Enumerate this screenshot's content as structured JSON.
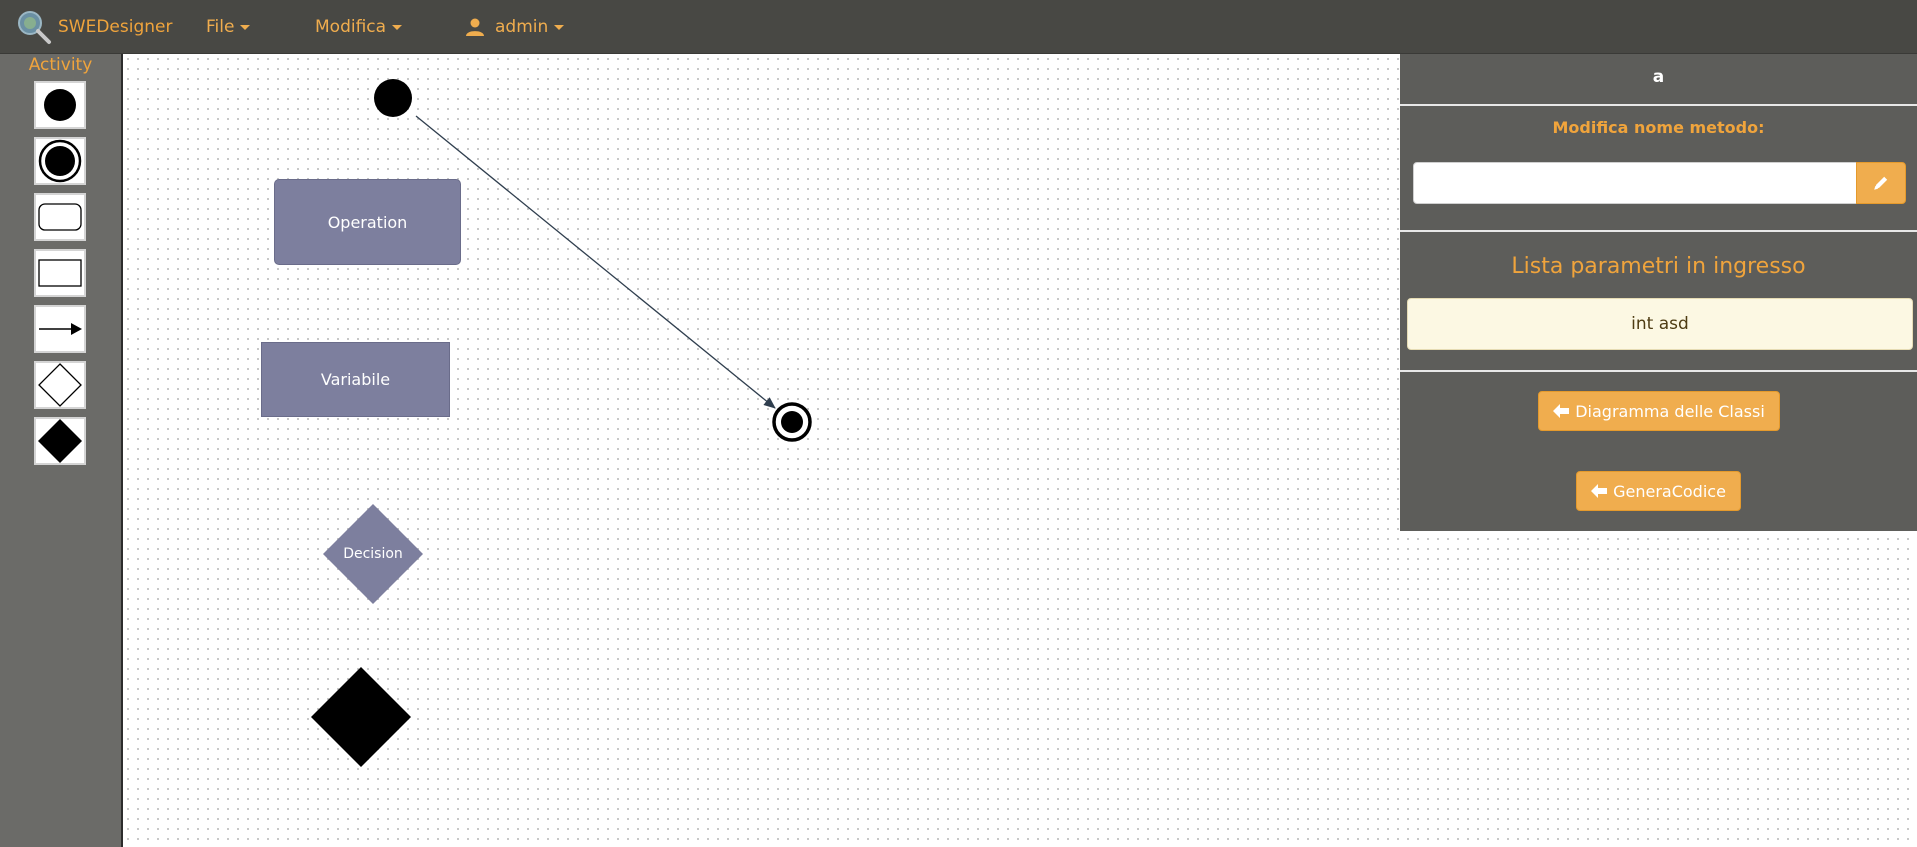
{
  "app": {
    "brand": "SWEDesigner",
    "logo_icon": "magnifier-logo-icon"
  },
  "navbar": {
    "menus": [
      {
        "label": "File",
        "icon": "caret-down-icon"
      },
      {
        "label": "Modifica",
        "icon": "caret-down-icon"
      }
    ],
    "user": {
      "label": "admin",
      "icon": "user-icon"
    }
  },
  "palette": {
    "title": "Activity",
    "tools": [
      {
        "name": "initial-node",
        "icon": "filled-circle-icon"
      },
      {
        "name": "final-node",
        "icon": "bullseye-circle-icon"
      },
      {
        "name": "operation",
        "icon": "rounded-rect-icon"
      },
      {
        "name": "variable",
        "icon": "rect-icon"
      },
      {
        "name": "transition",
        "icon": "arrow-right-icon"
      },
      {
        "name": "decision",
        "icon": "hollow-diamond-icon"
      },
      {
        "name": "merge",
        "icon": "filled-diamond-icon"
      }
    ]
  },
  "canvas": {
    "nodes": {
      "operation": "Operation",
      "variable": "Variabile",
      "decision": "Decision"
    }
  },
  "panel": {
    "title": "a",
    "rename_label": "Modifica nome metodo:",
    "rename_value": "",
    "rename_placeholder": "",
    "rename_button_icon": "pencil-icon",
    "params_title": "Lista parametri in ingresso",
    "params": [
      "int asd"
    ],
    "buttons": {
      "class_diagram": "Diagramma delle Classi",
      "generate_code": "GeneraCodice"
    },
    "button_icon": "arrow-left-icon"
  },
  "colors": {
    "navbar_bg": "#484844",
    "accent": "#f0ad4e",
    "palette_bg": "#6b6b68",
    "panel_bg": "#5d5d5a",
    "node_fill": "#7d7f9e",
    "param_bg": "#fcf8e3"
  }
}
